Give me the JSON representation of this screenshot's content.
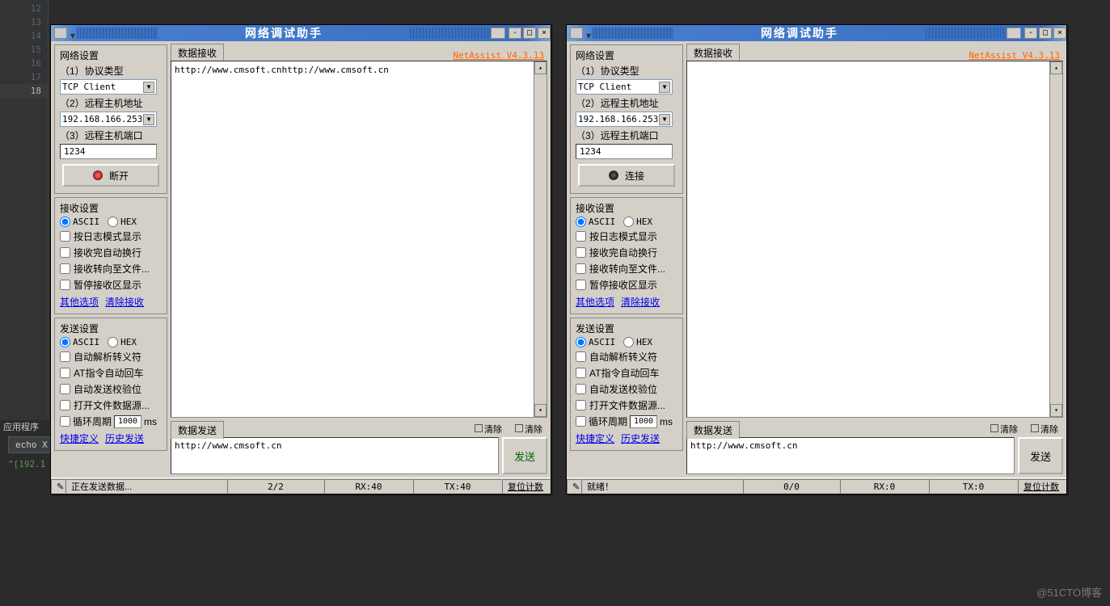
{
  "editor_lines": [
    "12",
    "13",
    "14",
    "15",
    "16",
    "17",
    "18"
  ],
  "editor_hl": "18",
  "bottom": {
    "tab": "应用程序",
    "entry": "echo  X",
    "out": "\"[192.1"
  },
  "watermark": "@51CTO博客",
  "title": "网络调试助手",
  "version": "NetAssist V4.3.13",
  "tab_recv": "数据接收",
  "tab_send": "数据发送",
  "btn_clear": "清除",
  "btn_reset": "复位计数",
  "net": {
    "title": "网络设置",
    "f1": "（1）协议类型",
    "f2": "（2）远程主机地址",
    "f3": "（3）远程主机端口",
    "proto": "TCP Client",
    "host": "192.168.166.253",
    "port": "1234"
  },
  "recv_cfg": {
    "title": "接收设置",
    "ascii": "ASCII",
    "hex": "HEX",
    "c1": "按日志模式显示",
    "c2": "接收完自动换行",
    "c3": "接收转向至文件...",
    "c4": "暂停接收区显示",
    "l1": "其他选项",
    "l2": "清除接收"
  },
  "send_cfg": {
    "title": "发送设置",
    "ascii": "ASCII",
    "hex": "HEX",
    "c1": "自动解析转义符",
    "c2": "AT指令自动回车",
    "c3": "自动发送校验位",
    "c4": "打开文件数据源...",
    "c5": "循环周期",
    "period": "1000",
    "unit": "ms",
    "l1": "快捷定义",
    "l2": "历史发送"
  },
  "a": {
    "connbtn": "断开",
    "recv": "http://www.cmsoft.cnhttp://www.cmsoft.cn",
    "sendtxt": "http://www.cmsoft.cn",
    "sendbtn": "发送",
    "status": "正在发送数据...",
    "count": "2/2",
    "rx": "RX:40",
    "tx": "TX:40"
  },
  "b": {
    "connbtn": "连接",
    "recv": "",
    "sendtxt": "http://www.cmsoft.cn",
    "sendbtn": "发送",
    "status": "就绪！",
    "count": "0/0",
    "rx": "RX:0",
    "tx": "TX:0"
  }
}
